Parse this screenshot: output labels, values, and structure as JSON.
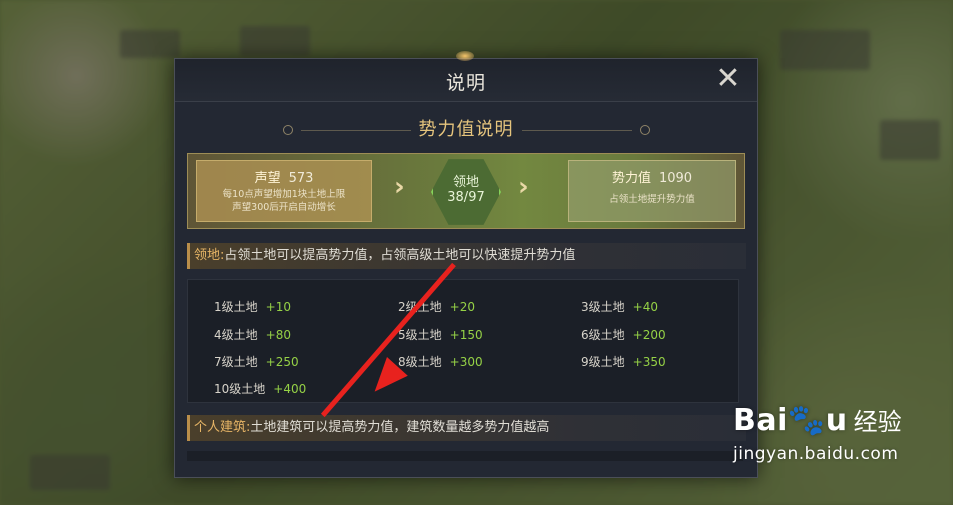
{
  "dialog": {
    "title": "说明",
    "close_icon": "close-icon",
    "section_title": "势力值说明",
    "flow": {
      "left_label": "声望",
      "left_value": "573",
      "left_desc_line1": "每10点声望增加1块土地上限",
      "left_desc_line2": "声望300后开启自动增长",
      "center_label": "领地",
      "center_value": "38/97",
      "right_label": "势力值",
      "right_value": "1090",
      "right_desc": "占领土地提升势力值"
    },
    "territory_bar": {
      "label": "领地:",
      "text": "占领土地可以提高势力值，占领高级土地可以快速提升势力值"
    },
    "land_levels": [
      {
        "name": "1级土地",
        "bonus": "+10"
      },
      {
        "name": "2级土地",
        "bonus": "+20"
      },
      {
        "name": "3级土地",
        "bonus": "+40"
      },
      {
        "name": "4级土地",
        "bonus": "+80"
      },
      {
        "name": "5级土地",
        "bonus": "+150"
      },
      {
        "name": "6级土地",
        "bonus": "+200"
      },
      {
        "name": "7级土地",
        "bonus": "+250"
      },
      {
        "name": "8级土地",
        "bonus": "+300"
      },
      {
        "name": "9级土地",
        "bonus": "+350"
      },
      {
        "name": "10级土地",
        "bonus": "+400"
      }
    ],
    "building_bar": {
      "label": "个人建筑:",
      "text": "土地建筑可以提高势力值，建筑数量越多势力值越高"
    }
  },
  "watermark": {
    "brand": "Bai",
    "brand_suffix": "u",
    "cn": "经验",
    "url": "jingyan.baidu.com"
  },
  "colors": {
    "accent_gold": "#e5c47d",
    "bonus_green": "#95d146",
    "arrow_red": "#e8221e"
  }
}
